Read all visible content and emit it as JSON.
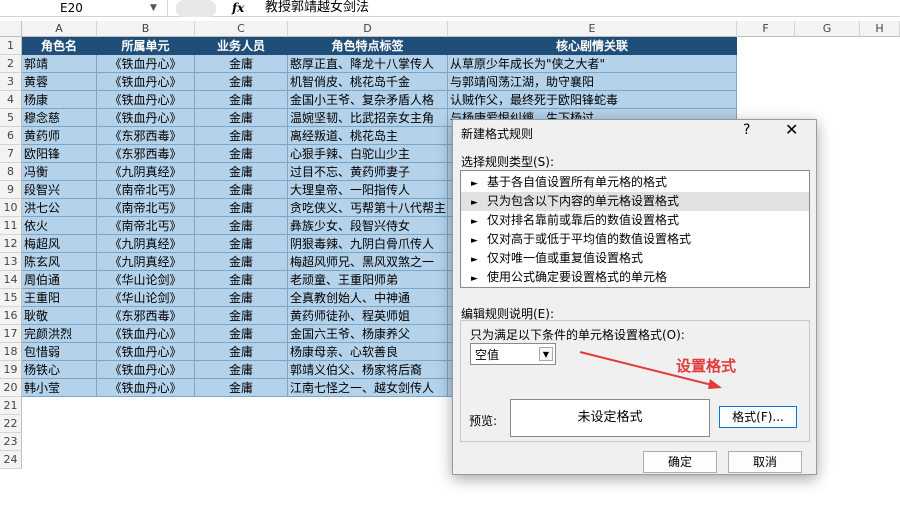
{
  "formula_bar": {
    "name_box": "E20",
    "fx_label": "fx",
    "formula": "教授郭靖越女剑法"
  },
  "columns": [
    "A",
    "B",
    "C",
    "D",
    "E",
    "F",
    "G",
    "H"
  ],
  "row_numbers": [
    "1",
    "2",
    "3",
    "4",
    "5",
    "6",
    "7",
    "8",
    "9",
    "10",
    "11",
    "12",
    "13",
    "14",
    "15",
    "16",
    "17",
    "18",
    "19",
    "20",
    "21",
    "22",
    "23",
    "24"
  ],
  "headers": [
    "角色名",
    "所属单元",
    "业务人员",
    "角色特点标签",
    "核心剧情关联"
  ],
  "rows": [
    [
      "郭靖",
      "《铁血丹心》",
      "金庸",
      "憨厚正直、降龙十八掌传人",
      "从草原少年成长为\"侠之大者\""
    ],
    [
      "黄蓉",
      "《铁血丹心》",
      "金庸",
      "机智俏皮、桃花岛千金",
      "与郭靖闯荡江湖，助守襄阳"
    ],
    [
      "杨康",
      "《铁血丹心》",
      "金庸",
      "金国小王爷、复杂矛盾人格",
      "认贼作父，最终死于欧阳锋蛇毒"
    ],
    [
      "穆念慈",
      "《铁血丹心》",
      "金庸",
      "温婉坚韧、比武招亲女主角",
      "与杨康爱恨纠缠，生下杨过"
    ],
    [
      "黄药师",
      "《东邪西毒》",
      "金庸",
      "离经叛道、桃花岛主",
      ""
    ],
    [
      "欧阳锋",
      "《东邪西毒》",
      "金庸",
      "心狠手辣、白驼山少主",
      ""
    ],
    [
      "冯衡",
      "《九阴真经》",
      "金庸",
      "过目不忘、黄药师妻子",
      ""
    ],
    [
      "段智兴",
      "《南帝北丐》",
      "金庸",
      "大理皇帝、一阳指传人",
      ""
    ],
    [
      "洪七公",
      "《南帝北丐》",
      "金庸",
      "贪吃侠义、丐帮第十八代帮主",
      ""
    ],
    [
      "依火",
      "《南帝北丐》",
      "金庸",
      "彝族少女、段智兴侍女",
      ""
    ],
    [
      "梅超风",
      "《九阴真经》",
      "金庸",
      "阴狠毒辣、九阴白骨爪传人",
      ""
    ],
    [
      "陈玄风",
      "《九阴真经》",
      "金庸",
      "梅超风师兄、黑风双煞之一",
      ""
    ],
    [
      "周伯通",
      "《华山论剑》",
      "金庸",
      "老顽童、王重阳师弟",
      ""
    ],
    [
      "王重阳",
      "《华山论剑》",
      "金庸",
      "全真教创始人、中神通",
      ""
    ],
    [
      "耿敬",
      "《东邪西毒》",
      "金庸",
      "黄药师徒孙、程英师姐",
      ""
    ],
    [
      "完颜洪烈",
      "《铁血丹心》",
      "金庸",
      "金国六王爷、杨康养父",
      ""
    ],
    [
      "包惜弱",
      "《铁血丹心》",
      "金庸",
      "杨康母亲、心软善良",
      ""
    ],
    [
      "杨铁心",
      "《铁血丹心》",
      "金庸",
      "郭靖义伯父、杨家将后裔",
      ""
    ],
    [
      "韩小莹",
      "《铁血丹心》",
      "金庸",
      "江南七怪之一、越女剑传人",
      ""
    ]
  ],
  "dialog": {
    "title": "新建格式规则",
    "help": "?",
    "close": "✕",
    "select_type_label": "选择规则类型(S):",
    "rule_types": [
      "基于各自值设置所有单元格的格式",
      "只为包含以下内容的单元格设置格式",
      "仅对排名靠前或靠后的数值设置格式",
      "仅对高于或低于平均值的数值设置格式",
      "仅对唯一值或重复值设置格式",
      "使用公式确定要设置格式的单元格"
    ],
    "selected_rule_index": 1,
    "edit_desc_label": "编辑规则说明(E):",
    "condition_label": "只为满足以下条件的单元格设置格式(O):",
    "condition_value": "空值",
    "preview_label": "预览:",
    "preview_text": "未设定格式",
    "format_button": "格式(F)...",
    "ok_button": "确定",
    "cancel_button": "取消"
  },
  "annotation": {
    "text": "设置格式",
    "color": "#e03c3c"
  },
  "colors": {
    "header_bg": "#1f4e79",
    "data_bg": "#b4d2ea",
    "accent": "#0078d7"
  }
}
